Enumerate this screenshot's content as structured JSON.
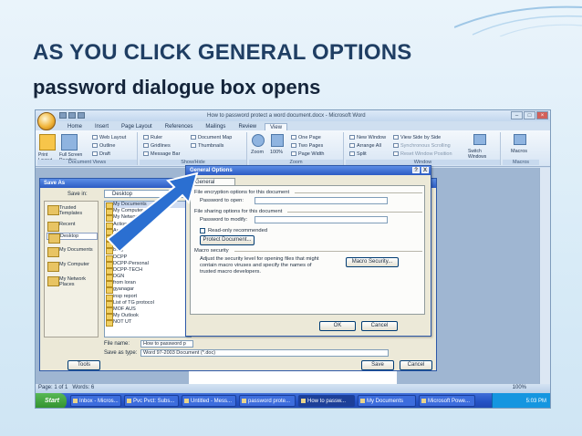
{
  "slide": {
    "heading": "AS YOU CLICK GENERAL OPTIONS",
    "subheading": "password dialogue box opens"
  },
  "word": {
    "title": "How to password protect a word document.docx - Microsoft Word",
    "tabs": [
      "Home",
      "Insert",
      "Page Layout",
      "References",
      "Mailings",
      "Review",
      "View"
    ],
    "active_tab": "View",
    "ribbon": {
      "print_layout": "Print Layout",
      "full_screen_reading": "Full Screen Reading",
      "web_layout": "Web Layout",
      "outline": "Outline",
      "draft": "Draft",
      "document_views": "Document Views",
      "ruler": "Ruler",
      "gridlines": "Gridlines",
      "message_bar": "Message Bar",
      "document_map": "Document Map",
      "thumbnails": "Thumbnails",
      "show_hide": "Show/Hide",
      "zoom": "Zoom",
      "zoom_pct": "100%",
      "one_page": "One Page",
      "two_pages": "Two Pages",
      "page_width": "Page Width",
      "zoom_group": "Zoom",
      "new_window": "New Window",
      "arrange_all": "Arrange All",
      "split": "Split",
      "view_side_by_side": "View Side by Side",
      "sync_scrolling": "Synchronous Scrolling",
      "reset_window": "Reset Window Position",
      "switch_windows": "Switch Windows",
      "window_group": "Window",
      "macros": "Macros",
      "macros_group": "Macros"
    },
    "status": {
      "page": "Page: 1 of 1",
      "words": "Words: 6",
      "zoom": "100%"
    }
  },
  "save_as": {
    "title": "Save As",
    "save_in_label": "Save in:",
    "save_in_value": "Desktop",
    "places": [
      "Trusted Templates",
      "Recent",
      "Desktop",
      "My Documents",
      "My Computer",
      "My Network Places"
    ],
    "selected_place": "Desktop",
    "files": [
      "My Documents",
      "My Computer",
      "My Network Places",
      "Action",
      "Aud.calls",
      "bb",
      "bcp",
      "Blog",
      "DCPP",
      "DCPP-Personal",
      "DCPP-TECH",
      "DGN",
      "from loran",
      "gyanagar",
      "insp report",
      "List of TG protocol",
      "MOF AUS",
      "My Outlook",
      "NOT UT"
    ],
    "file_name_label": "File name:",
    "file_name_value": "How to password p",
    "save_type_label": "Save as type:",
    "save_type_value": "Word 97-2003 Document (*.doc)",
    "tools": "Tools",
    "save": "Save",
    "cancel": "Cancel"
  },
  "general_options": {
    "title": "General Options",
    "tab": "General Options",
    "enc_section": "File encryption options for this document",
    "pw_open": "Password to open:",
    "share_section": "File sharing options for this document",
    "pw_modify": "Password to modify:",
    "read_only": "Read-only recommended",
    "protect": "Protect Document...",
    "macro_section": "Macro security",
    "macro_desc1": "Adjust the security level for opening files that might",
    "macro_desc2": "contain macro viruses and specify the names of",
    "macro_desc3": "trusted macro developers.",
    "macro_btn": "Macro Security...",
    "ok": "OK",
    "cancel": "Cancel",
    "help": "?",
    "close": "X"
  },
  "taskbar": {
    "start": "Start",
    "items": [
      "Inbox - Micros...",
      "Pvc Pvct: Subs...",
      "Untitled - Mess...",
      "password prote...",
      "How to passw...",
      "My Documents",
      "Microsoft Powe..."
    ],
    "active_index": 4,
    "clock": "5:03 PM"
  },
  "colors": {
    "heading": "#1f3e63",
    "arrow": "#2b6fd1",
    "dialog_title": "#2c5bc3"
  }
}
